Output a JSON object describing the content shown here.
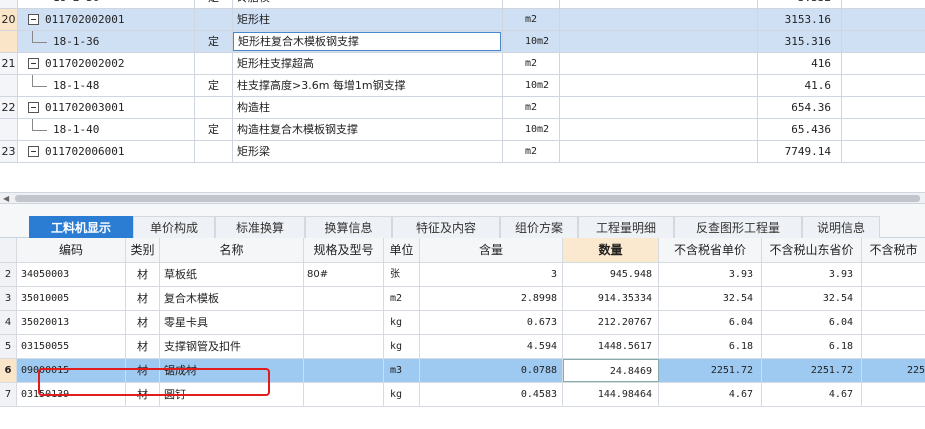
{
  "upper_rows": [
    {
      "num": "",
      "code": "18-2-36",
      "type": "定",
      "name": "砖胎模",
      "unit": "10m2",
      "value": "3.332",
      "kind": "child",
      "partial": "top"
    },
    {
      "num": "20",
      "code": "011702002001",
      "type": "",
      "name": "矩形柱",
      "unit": "m2",
      "value": "3153.16",
      "kind": "parent",
      "selected": true
    },
    {
      "num": "",
      "code": "18-1-36",
      "type": "定",
      "name": "矩形柱复合木模板钢支撑",
      "unit": "10m2",
      "value": "315.316",
      "kind": "child",
      "selected": true,
      "editing": true
    },
    {
      "num": "21",
      "code": "011702002002",
      "type": "",
      "name": "矩形柱支撑超高",
      "unit": "m2",
      "value": "416",
      "kind": "parent"
    },
    {
      "num": "",
      "code": "18-1-48",
      "type": "定",
      "name": "柱支撑高度>3.6m 每增1m钢支撑",
      "unit": "10m2",
      "value": "41.6",
      "kind": "child"
    },
    {
      "num": "22",
      "code": "011702003001",
      "type": "",
      "name": "构造柱",
      "unit": "m2",
      "value": "654.36",
      "kind": "parent"
    },
    {
      "num": "",
      "code": "18-1-40",
      "type": "定",
      "name": "构造柱复合木模板钢支撑",
      "unit": "10m2",
      "value": "65.436",
      "kind": "child"
    },
    {
      "num": "23",
      "code": "011702006001",
      "type": "",
      "name": "矩形梁",
      "unit": "m2",
      "value": "7749.14",
      "kind": "parent",
      "partial": "bottom"
    }
  ],
  "tabs": [
    {
      "label": "工料机显示",
      "active": true
    },
    {
      "label": "单价构成"
    },
    {
      "label": "标准换算"
    },
    {
      "label": "换算信息"
    },
    {
      "label": "特征及内容"
    },
    {
      "label": "组价方案"
    },
    {
      "label": "工程量明细"
    },
    {
      "label": "反查图形工程量"
    },
    {
      "label": "说明信息"
    }
  ],
  "lower_headers": [
    "",
    "编码",
    "类别",
    "名称",
    "规格及型号",
    "单位",
    "含量",
    "数量",
    "不含税省单价",
    "不含税山东省价",
    "不含税市"
  ],
  "lower_rows": [
    {
      "num": "2",
      "code": "34050003",
      "type": "材",
      "name": "草板纸",
      "spec": "80#",
      "unit": "张",
      "content": "3",
      "qty": "945.948",
      "price": "3.93",
      "sd_price": "3.93",
      "city": ""
    },
    {
      "num": "3",
      "code": "35010005",
      "type": "材",
      "name": "复合木模板",
      "spec": "",
      "unit": "m2",
      "content": "2.8998",
      "qty": "914.35334",
      "price": "32.54",
      "sd_price": "32.54",
      "city": ""
    },
    {
      "num": "4",
      "code": "35020013",
      "type": "材",
      "name": "零星卡具",
      "spec": "",
      "unit": "kg",
      "content": "0.673",
      "qty": "212.20767",
      "price": "6.04",
      "sd_price": "6.04",
      "city": ""
    },
    {
      "num": "5",
      "code": "03150055",
      "type": "材",
      "name": "支撑钢管及扣件",
      "spec": "",
      "unit": "kg",
      "content": "4.594",
      "qty": "1448.5617",
      "price": "6.18",
      "sd_price": "6.18",
      "city": ""
    },
    {
      "num": "6",
      "code": "09000015",
      "type": "材",
      "name": "锯成材",
      "spec": "",
      "unit": "m3",
      "content": "0.0788",
      "qty": "24.8469",
      "price": "2251.72",
      "sd_price": "2251.72",
      "city": "225",
      "selected": true
    },
    {
      "num": "7",
      "code": "03150139",
      "type": "材",
      "name": "圆钉",
      "spec": "",
      "unit": "kg",
      "content": "0.4583",
      "qty": "144.98464",
      "price": "4.67",
      "sd_price": "4.67",
      "city": "",
      "partial": "bottom"
    }
  ],
  "colors": {
    "accent": "#2b7cd3",
    "selected_row": "#cfe0f5",
    "highlight_box": "#e21b1b"
  }
}
